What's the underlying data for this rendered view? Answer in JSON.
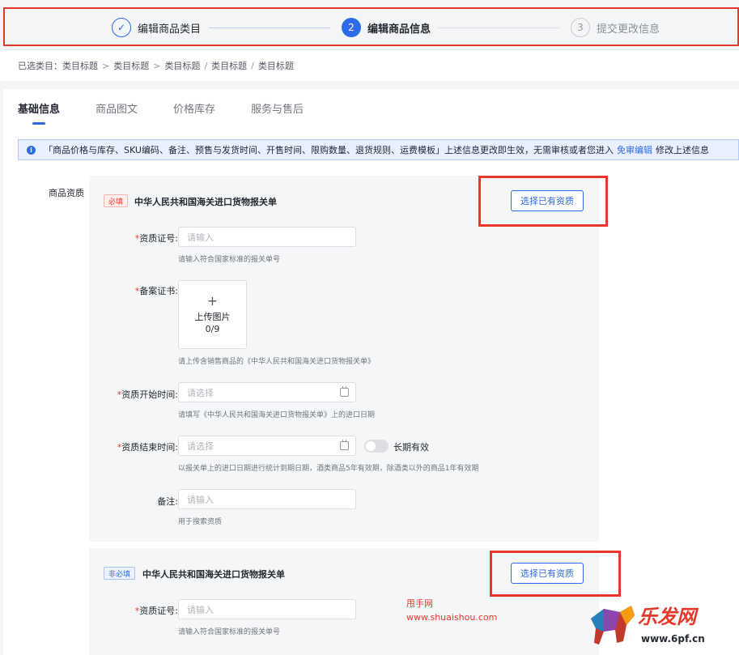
{
  "stepper": {
    "steps": [
      {
        "index": "✓",
        "label": "编辑商品类目",
        "state": "done"
      },
      {
        "index": "2",
        "label": "编辑商品信息",
        "state": "active"
      },
      {
        "index": "3",
        "label": "提交更改信息",
        "state": "todo"
      }
    ]
  },
  "breadcrumb": {
    "prefix": "已选类目：",
    "items": [
      "类目标题",
      "类目标题",
      "类目标题",
      "类目标题",
      "类目标题"
    ],
    "seps": [
      ">",
      ">",
      "/",
      "/"
    ]
  },
  "tabs": [
    "基础信息",
    "商品图文",
    "价格库存",
    "服务与售后"
  ],
  "notice": {
    "icon": "info-icon",
    "text": "「商品价格与库存、SKU编码、备注、预售与发货时间、开售时间、限购数量、退货规则、运费模板」上述信息更改即生效，无需审核或者您进入",
    "link": "免审编辑",
    "suffix": "修改上述信息"
  },
  "section_label": "商品资质",
  "panel1": {
    "tag": "必填",
    "title": "中华人民共和国海关进口货物报关单",
    "pick_button": "选择已有资质",
    "fields": {
      "cert_no": {
        "label": "资质证号:",
        "placeholder": "请输入",
        "hint": "请输入符合国家标准的报关单号"
      },
      "record": {
        "label": "备案证书:",
        "upload_text": "上传图片",
        "upload_count": "0/9",
        "hint": "请上传含销售商品的《中华人民共和国海关进口货物报关单》"
      },
      "start_time": {
        "label": "资质开始时间:",
        "placeholder": "请选择",
        "hint": "请填写《中华人民共和国海关进口货物报关单》上的进口日期"
      },
      "end_time": {
        "label": "资质结束时间:",
        "placeholder": "请选择",
        "switch_label": "长期有效",
        "hint": "以报关单上的进口日期进行统计到期日期，酒类商品5年有效期，除酒类以外的商品1年有效期"
      },
      "remark": {
        "label": "备注:",
        "placeholder": "请输入",
        "hint": "用于搜索资质"
      }
    }
  },
  "panel2": {
    "tag": "非必填",
    "title": "中华人民共和国海关进口货物报关单",
    "pick_button": "选择已有资质",
    "fields": {
      "cert_no": {
        "label": "资质证号:",
        "placeholder": "请输入",
        "hint": "请输入符合国家标准的报关单号"
      }
    }
  },
  "watermark": {
    "line1": "甩手网",
    "line2": "www.shuaishou.com",
    "brand": "乐发网",
    "url": "www.6pf.cn"
  },
  "colors": {
    "accent": "#2e6be6",
    "highlight": "#e5382a"
  }
}
